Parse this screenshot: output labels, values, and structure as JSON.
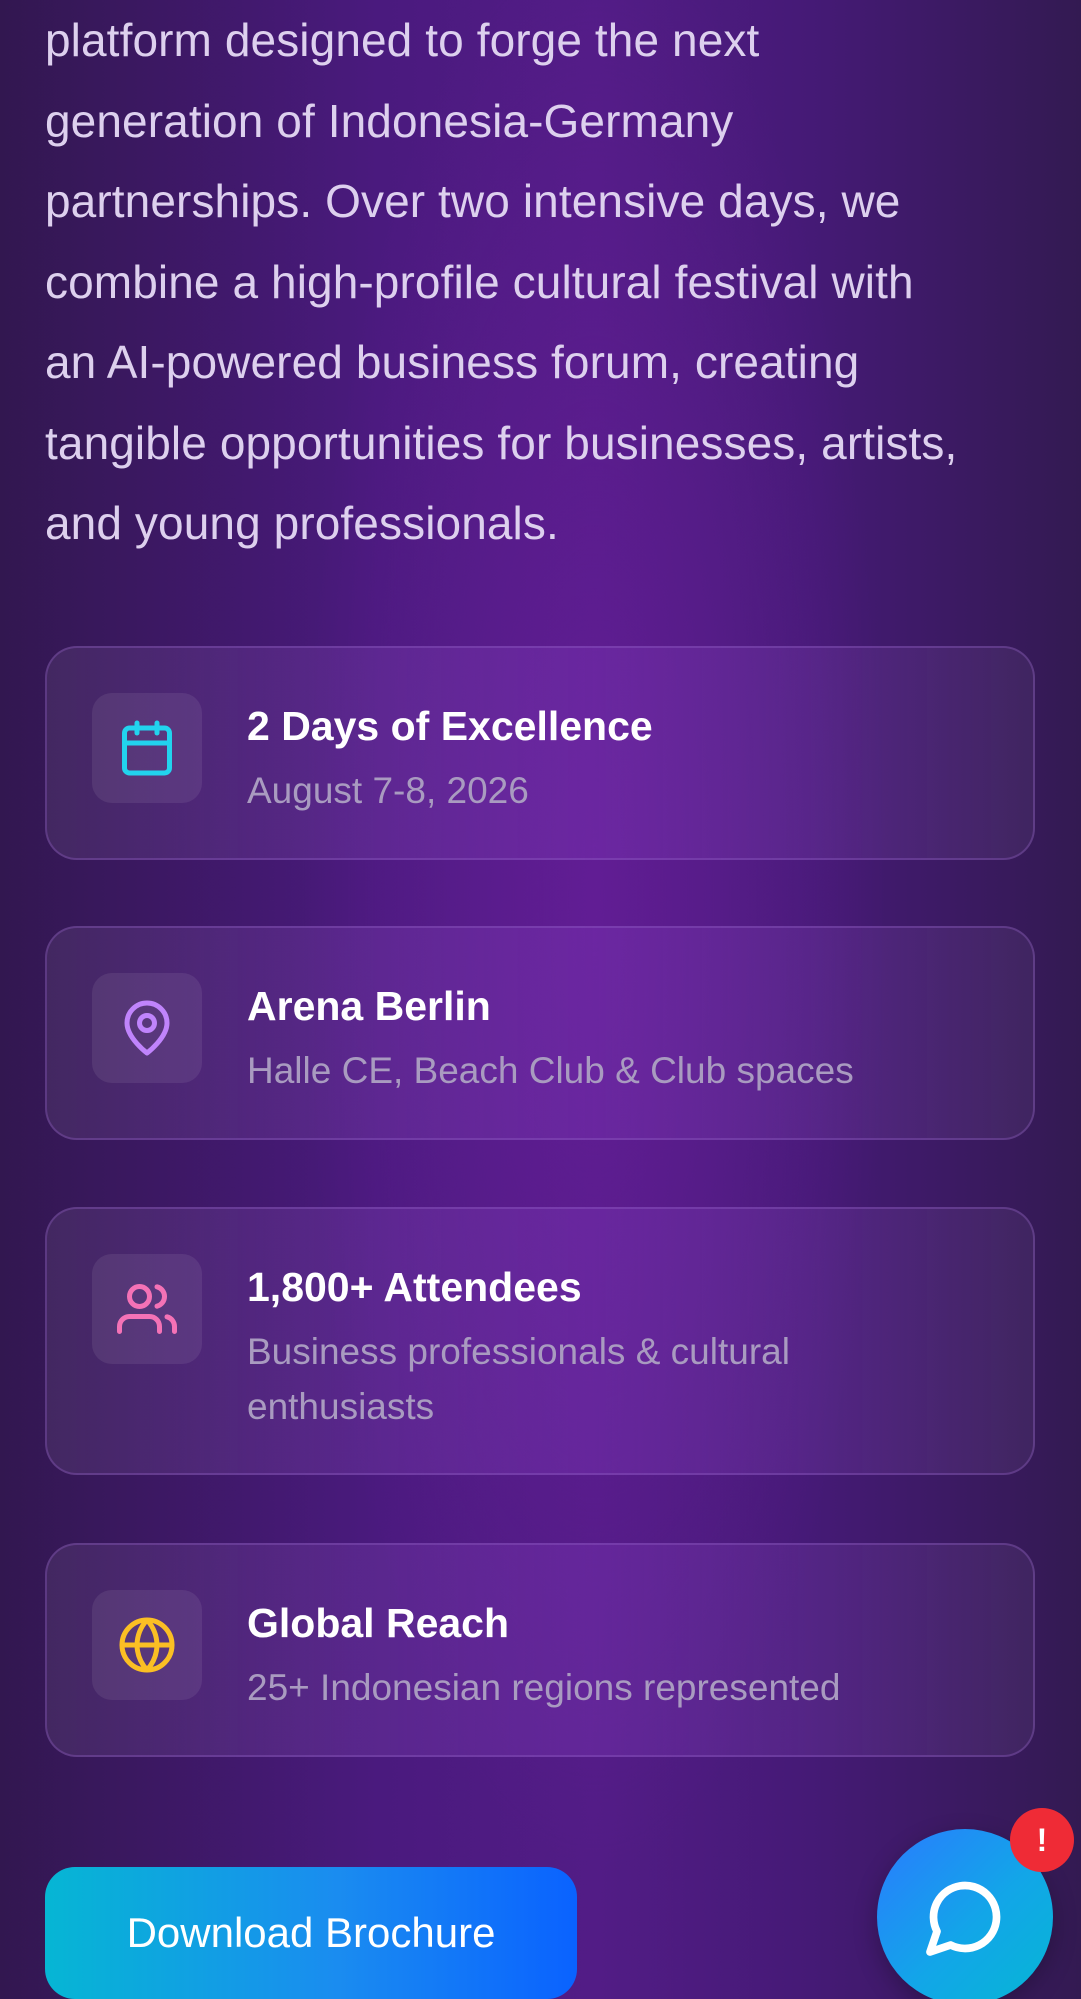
{
  "intro": {
    "lines": [
      "platform designed to forge the next",
      "generation of Indonesia-Germany",
      "partnerships. Over two intensive days, we",
      "combine a high-profile cultural festival with",
      "an AI-powered business forum, creating",
      "tangible opportunities for businesses, artists,",
      "and young professionals."
    ]
  },
  "features": [
    {
      "title": "2 Days of Excellence",
      "subtitle_lines": [
        "August 7-8, 2026"
      ],
      "icon": "calendar-icon",
      "icon_color": "#22d3ee"
    },
    {
      "title": "Arena Berlin",
      "subtitle_lines": [
        "Halle CE, Beach Club & Club spaces"
      ],
      "icon": "map-pin-icon",
      "icon_color": "#c084fc"
    },
    {
      "title": "1,800+ Attendees",
      "subtitle_lines": [
        "Business professionals & cultural",
        "enthusiasts"
      ],
      "icon": "users-icon",
      "icon_color": "#f472b6"
    },
    {
      "title": "Global Reach",
      "subtitle_lines": [
        "25+ Indonesian regions represented"
      ],
      "icon": "globe-icon",
      "icon_color": "#fbbf24"
    }
  ],
  "cta": {
    "download_label": "Download Brochure"
  },
  "chat": {
    "icon": "chat-bubble-icon",
    "badge": "!"
  }
}
